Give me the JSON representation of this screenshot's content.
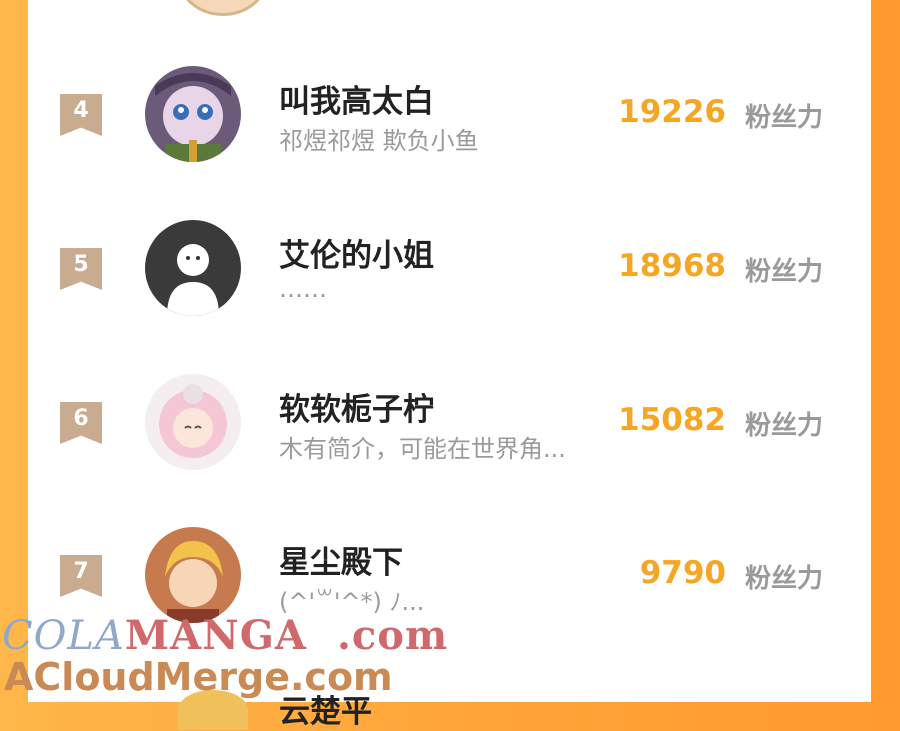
{
  "leaderboard": {
    "entries": [
      {
        "rank": "4",
        "name": "叫我高太白",
        "bio": "祁煜祁煜 欺负小鱼",
        "score": "19226",
        "unit": "粉丝力"
      },
      {
        "rank": "5",
        "name": "艾伦的小姐",
        "bio": "……",
        "score": "18968",
        "unit": "粉丝力"
      },
      {
        "rank": "6",
        "name": "软软栀子柠",
        "bio": "木有简介，可能在世界角...",
        "score": "15082",
        "unit": "粉丝力"
      },
      {
        "rank": "7",
        "name": "星尘殿下",
        "bio": "(^'꒳'^*) ﾉ...",
        "score": "9790",
        "unit": "粉丝力"
      }
    ],
    "partial_next_name": "云楚平"
  },
  "watermark": {
    "line1_part1": "COLA",
    "line1_part2": "MANGA",
    "line1_part3": ".com",
    "line2": "ACloudMerge.com"
  },
  "colors": {
    "accent": "#f5a623",
    "rank_badge": "#c9ab8f",
    "background": "#ffa53a"
  }
}
